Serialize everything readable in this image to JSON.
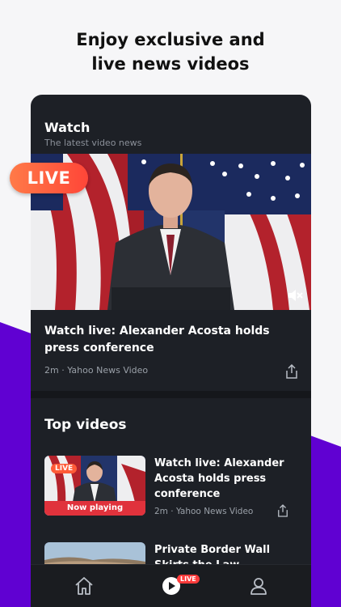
{
  "promo": {
    "line1": "Enjoy exclusive and",
    "line2": "live news videos",
    "live_badge": "LIVE"
  },
  "watch": {
    "title": "Watch",
    "subtitle": "The latest video news",
    "featured": {
      "caption": "Watch live: Alexander Acosta holds press conference",
      "age": "2m",
      "source": "Yahoo News Video"
    }
  },
  "top_videos": {
    "title": "Top videos",
    "items": [
      {
        "title": "Watch live: Alexander Acosta holds press conference",
        "age": "2m",
        "source": "Yahoo News Video",
        "live_badge": "LIVE",
        "status": "Now playing"
      },
      {
        "title": "Private Border Wall Skirts the Law"
      }
    ]
  },
  "tabbar": {
    "live_badge": "LIVE"
  },
  "colors": {
    "accent_purple": "#6001d2",
    "live_orange": "#ff5a3c",
    "now_playing_red": "#e0323c",
    "card_bg": "#1d2026"
  }
}
